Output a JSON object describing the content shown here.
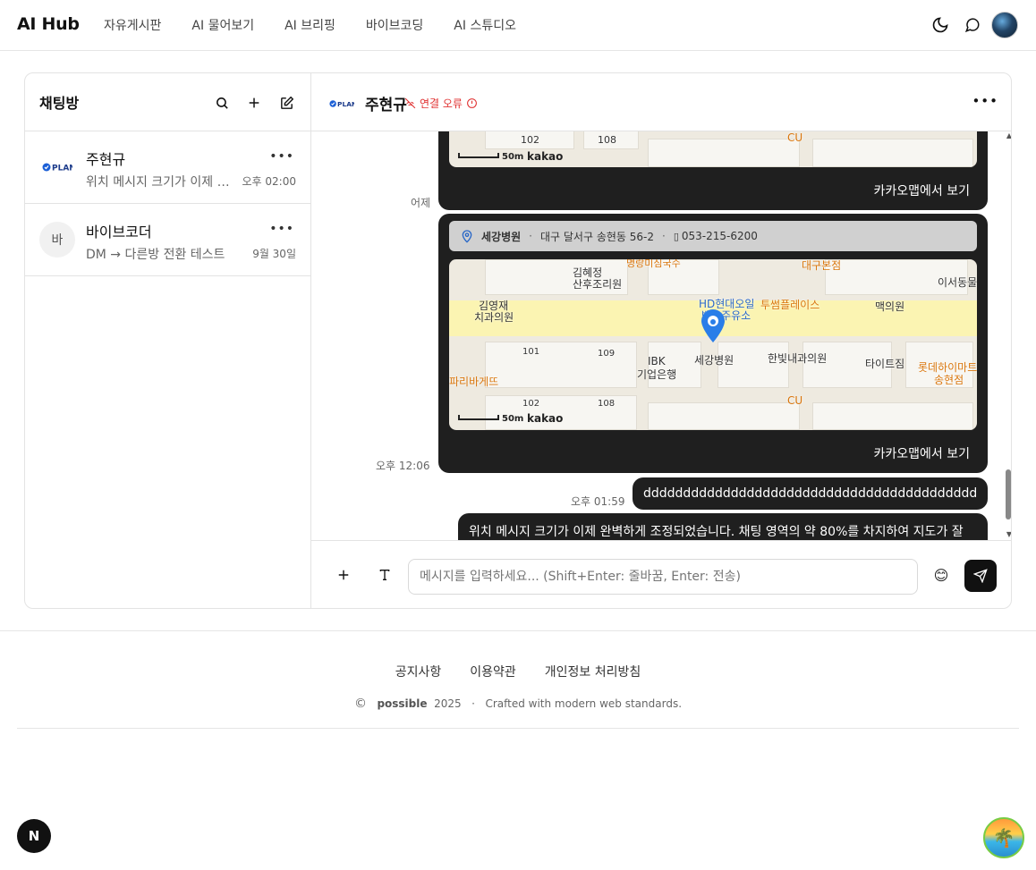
{
  "app": {
    "title": "AI Hub"
  },
  "nav": {
    "items": [
      "자유게시판",
      "AI 물어보기",
      "AI 브리핑",
      "바이브코딩",
      "AI 스튜디오"
    ]
  },
  "sidebar": {
    "title": "채팅방",
    "rooms": [
      {
        "name": "주현규",
        "preview": "위치 메시지 크기가 이제 완벽하게 조정되었습니다.",
        "time": "오후 02:00",
        "avatar_text": "PLAN"
      },
      {
        "name": "바이브코더",
        "preview": "DM → 다른방 전환 테스트",
        "time": "9월 30일",
        "avatar_text": "바"
      }
    ]
  },
  "chat": {
    "header_logo": "PLAN",
    "peer_name": "주현규",
    "status": "연결 오류",
    "messages": {
      "map1": {
        "open_label": "카카오맵에서 보기",
        "timestamp": "어제",
        "scale": "50m",
        "brand": "kakao",
        "labels": [
          "102",
          "108",
          "CU"
        ]
      },
      "map2": {
        "place": "세강병원",
        "address": "대구 달서구 송현동 56-2",
        "phone": "053-215-6200",
        "separator": "·",
        "scale": "50m",
        "brand": "kakao",
        "open_label": "카카오맵에서 보기",
        "timestamp": "오후 12:06",
        "map_labels": {
          "a": "김혜정",
          "b": "산후조리원",
          "c": "김영재",
          "d": "치과의원",
          "e": "HD현대오일",
          "f": "뱅크주유소",
          "g": "투썸플레이스",
          "h": "맥의원",
          "i": "이서동물",
          "j": "대구본점",
          "k": "IBK",
          "l": "기업은행",
          "m": "세강병원",
          "n": "한빛내과의원",
          "o": "타이트짐",
          "p": "롯데하이마트",
          "q": "송현점",
          "r": "파리바게뜨",
          "s": "CU",
          "t": "101",
          "u": "109",
          "v": "102",
          "w": "108",
          "x": "명랑미심국수"
        }
      },
      "text1": {
        "text": "dddddddddddddddddddddddddddddddddddddddddd",
        "timestamp": "오후 01:59"
      },
      "text2": {
        "text": "위치 메시지 크기가 이제 완벽하게 조정되었습니다. 채팅 영역의 약 80%를 차지하여 지도가 잘"
      }
    }
  },
  "composer": {
    "placeholder": "메시지를 입력하세요... (Shift+Enter: 줄바꿈, Enter: 전송)"
  },
  "footer": {
    "links": [
      "공지사항",
      "이용약관",
      "개인정보 처리방침"
    ],
    "copyright_symbol": "©",
    "brand": "possible",
    "year": "2025",
    "dot": "·",
    "tagline": "Crafted with modern web standards."
  },
  "floating": {
    "n_badge": "N"
  }
}
